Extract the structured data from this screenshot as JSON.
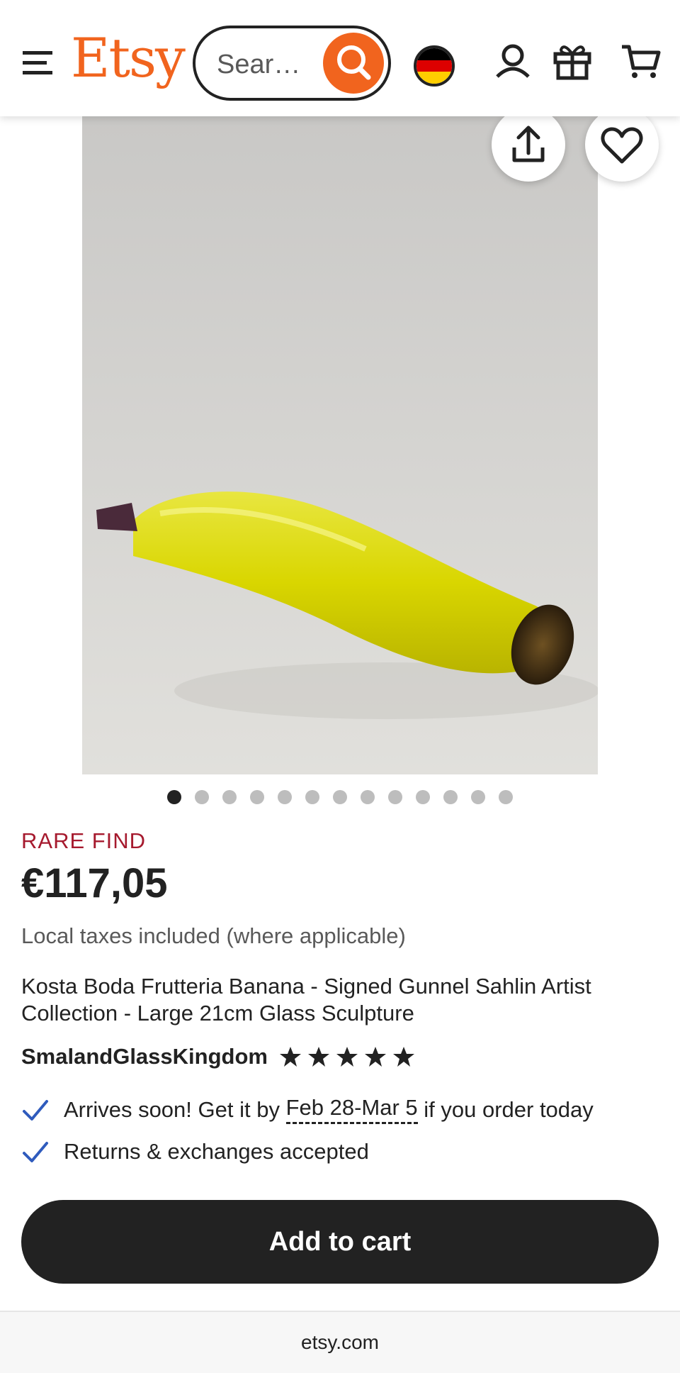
{
  "header": {
    "logo": "Etsy",
    "search_placeholder": "Sear…",
    "icons": [
      "menu-icon",
      "search-icon",
      "flag-germany",
      "user-icon",
      "gift-icon",
      "cart-icon"
    ]
  },
  "gallery": {
    "image_description_icons": [
      "share-icon",
      "heart-icon"
    ],
    "dot_count": 13,
    "active_dot": 1
  },
  "product": {
    "badge": "RARE FIND",
    "price": "€117,05",
    "tax_note": "Local taxes included (where applicable)",
    "title": "Kosta Boda Frutteria Banana - Signed Gunnel Sahlin Artist Collection - Large 21cm Glass Sculpture",
    "seller": "SmalandGlassKingdom",
    "rating_stars": 5
  },
  "features": {
    "arrives_prefix": "Arrives soon! Get it by ",
    "arrives_dates": "Feb 28-Mar 5",
    "arrives_suffix": " if you order today",
    "returns": "Returns & exchanges accepted"
  },
  "cta": {
    "add_to_cart": "Add to cart"
  },
  "footer": {
    "domain": "etsy.com"
  },
  "colors": {
    "brand": "#f1641e",
    "badge": "#a61a2e",
    "check": "#2f5bbd",
    "button": "#222222"
  }
}
